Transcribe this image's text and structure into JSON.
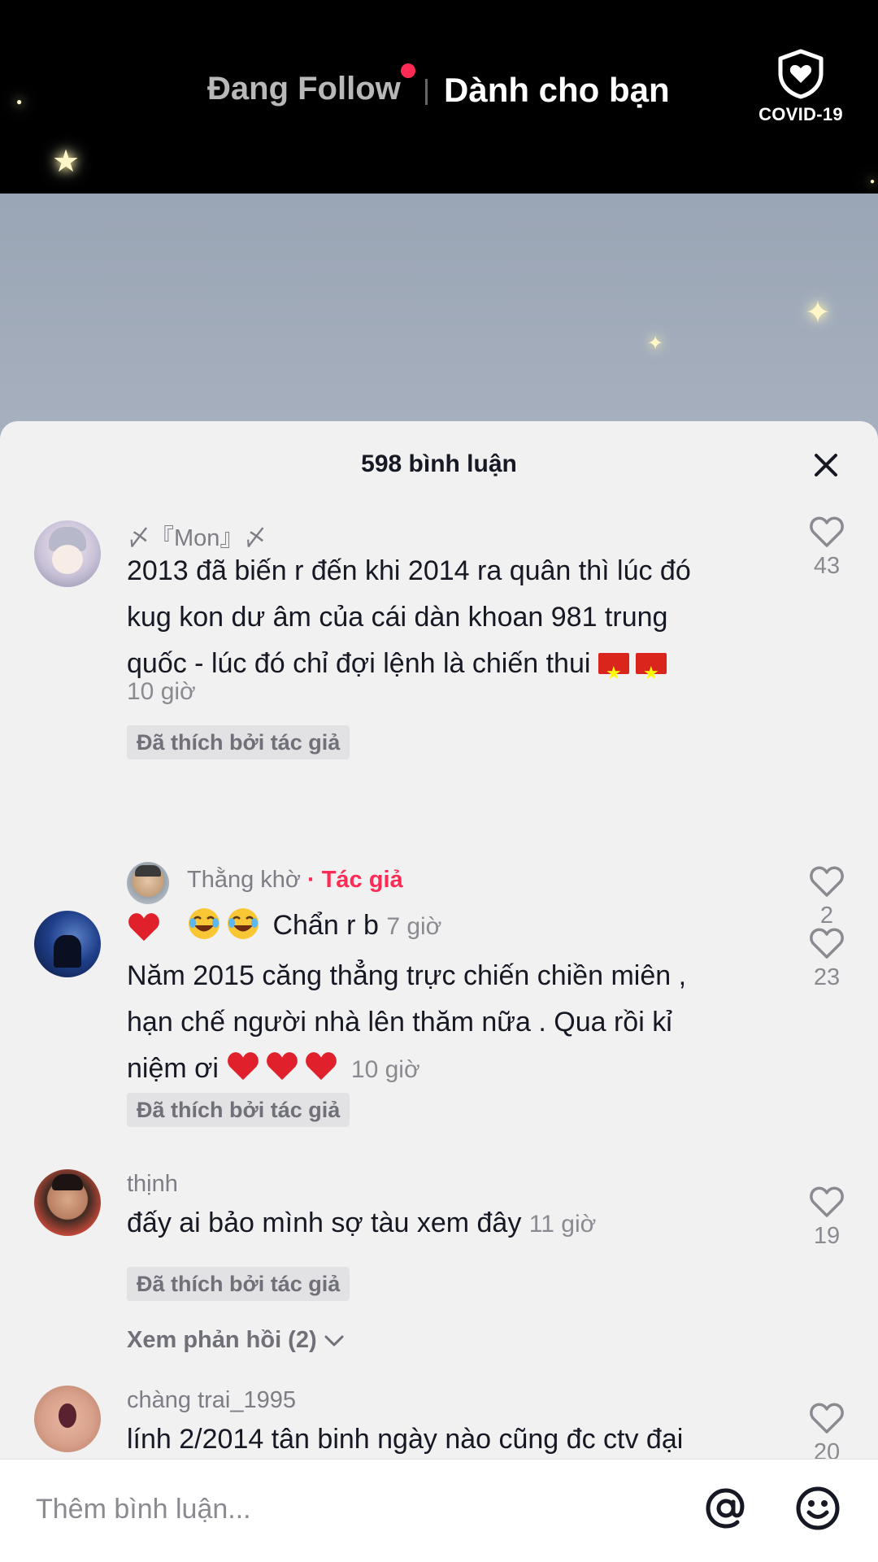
{
  "header": {
    "tab_following": "Đang Follow",
    "tab_foryou": "Dành cho bạn",
    "covid_label": "COVID-19"
  },
  "sheet": {
    "title": "598 bình luận"
  },
  "comments": [
    {
      "username": "〆『Mon』〆",
      "text": "2013 đã biến r đến khi 2014 ra quân thì lúc đó",
      "text2": "kug kon dư âm của cái dàn khoan 981 trung",
      "text3": "quốc - lúc đó chỉ đợi lệnh là chiến thui",
      "time": "10 giờ",
      "badge": "Đã thích bởi tác giả",
      "likes": "43",
      "reply": {
        "username": "Thằng khờ",
        "author_tag": "· Tác giả",
        "text": "Chẩn r b",
        "time": "7 giờ",
        "likes": "2"
      }
    },
    {
      "text": "Năm 2015 căng thẳng trực chiến chiền miên ,",
      "text2": "hạn chế người nhà lên thăm nữa . Qua rồi kỉ",
      "text3": "niệm ơi",
      "time": "10 giờ",
      "badge": "Đã thích bởi tác giả",
      "likes": "23"
    },
    {
      "username": "thịnh",
      "text": "đấy ai bảo mình sợ tàu xem đây",
      "time": "11 giờ",
      "badge": "Đã thích bởi tác giả",
      "likes": "19",
      "view_replies": "Xem phản hồi (2)"
    },
    {
      "username": "chàng trai_1995",
      "text": "lính 2/2014 tân binh ngày nào cũng đc ctv đại",
      "likes": "20"
    }
  ],
  "input": {
    "placeholder": "Thêm bình luận..."
  },
  "colors": {
    "accent": "#fe2c55",
    "text_primary": "#161823",
    "text_secondary": "#8a8b91",
    "sheet_bg": "#f1f1f2"
  }
}
